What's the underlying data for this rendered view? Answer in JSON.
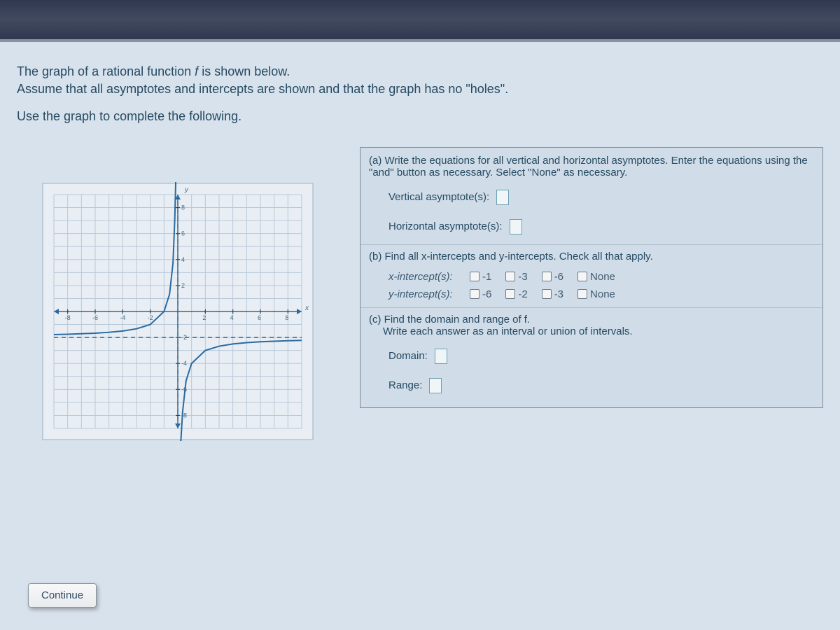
{
  "intro": {
    "line1_pre": "The graph of a rational function ",
    "line1_f": "f",
    "line1_post": " is shown below.",
    "line2": "Assume that all asymptotes and intercepts are shown and that the graph has no \"holes\".",
    "line3": "Use the graph to complete the following."
  },
  "parts": {
    "a": {
      "head": "(a) Write the equations for all vertical and horizontal asymptotes. Enter the equations using the \"and\" button as necessary. Select \"None\" as necessary.",
      "va_label": "Vertical asymptote(s):",
      "ha_label": "Horizontal asymptote(s):"
    },
    "b": {
      "head": "(b) Find all x-intercepts and y-intercepts. Check all that apply.",
      "xlabel": "x-intercept(s):",
      "ylabel": "y-intercept(s):",
      "x_options": [
        "-1",
        "-3",
        "-6",
        "None"
      ],
      "y_options": [
        "-6",
        "-2",
        "-3",
        "None"
      ]
    },
    "c": {
      "head": "(c) Find the domain and range of f.",
      "sub": "Write each answer as an interval or union of intervals.",
      "domain_label": "Domain:",
      "range_label": "Range:"
    }
  },
  "continue_label": "Continue",
  "chart_data": {
    "type": "line",
    "title": "",
    "xlabel": "x",
    "ylabel": "y",
    "xlim": [
      -9,
      9
    ],
    "ylim": [
      -9,
      9
    ],
    "x_ticks": [
      -8,
      -6,
      -4,
      -2,
      2,
      4,
      6,
      8
    ],
    "y_ticks": [
      -8,
      -6,
      -4,
      -2,
      2,
      4,
      6,
      8
    ],
    "vertical_asymptote": 0,
    "horizontal_asymptote": -2,
    "series": [
      {
        "name": "left-branch",
        "x": [
          -9,
          -8,
          -7,
          -6,
          -5,
          -4,
          -3,
          -2,
          -1,
          -0.6,
          -0.35,
          -0.22,
          -0.15
        ],
        "values": [
          -1.78,
          -1.75,
          -1.71,
          -1.67,
          -1.6,
          -1.5,
          -1.33,
          -1,
          0,
          1.33,
          3.71,
          7.09,
          11.3
        ]
      },
      {
        "name": "right-branch",
        "x": [
          0.15,
          0.22,
          0.35,
          0.6,
          1,
          2,
          3,
          4,
          5,
          6,
          7,
          8,
          9
        ],
        "values": [
          -15.3,
          -11.1,
          -7.71,
          -5.33,
          -4,
          -3,
          -2.67,
          -2.5,
          -2.4,
          -2.33,
          -2.29,
          -2.25,
          -2.22
        ]
      }
    ]
  }
}
